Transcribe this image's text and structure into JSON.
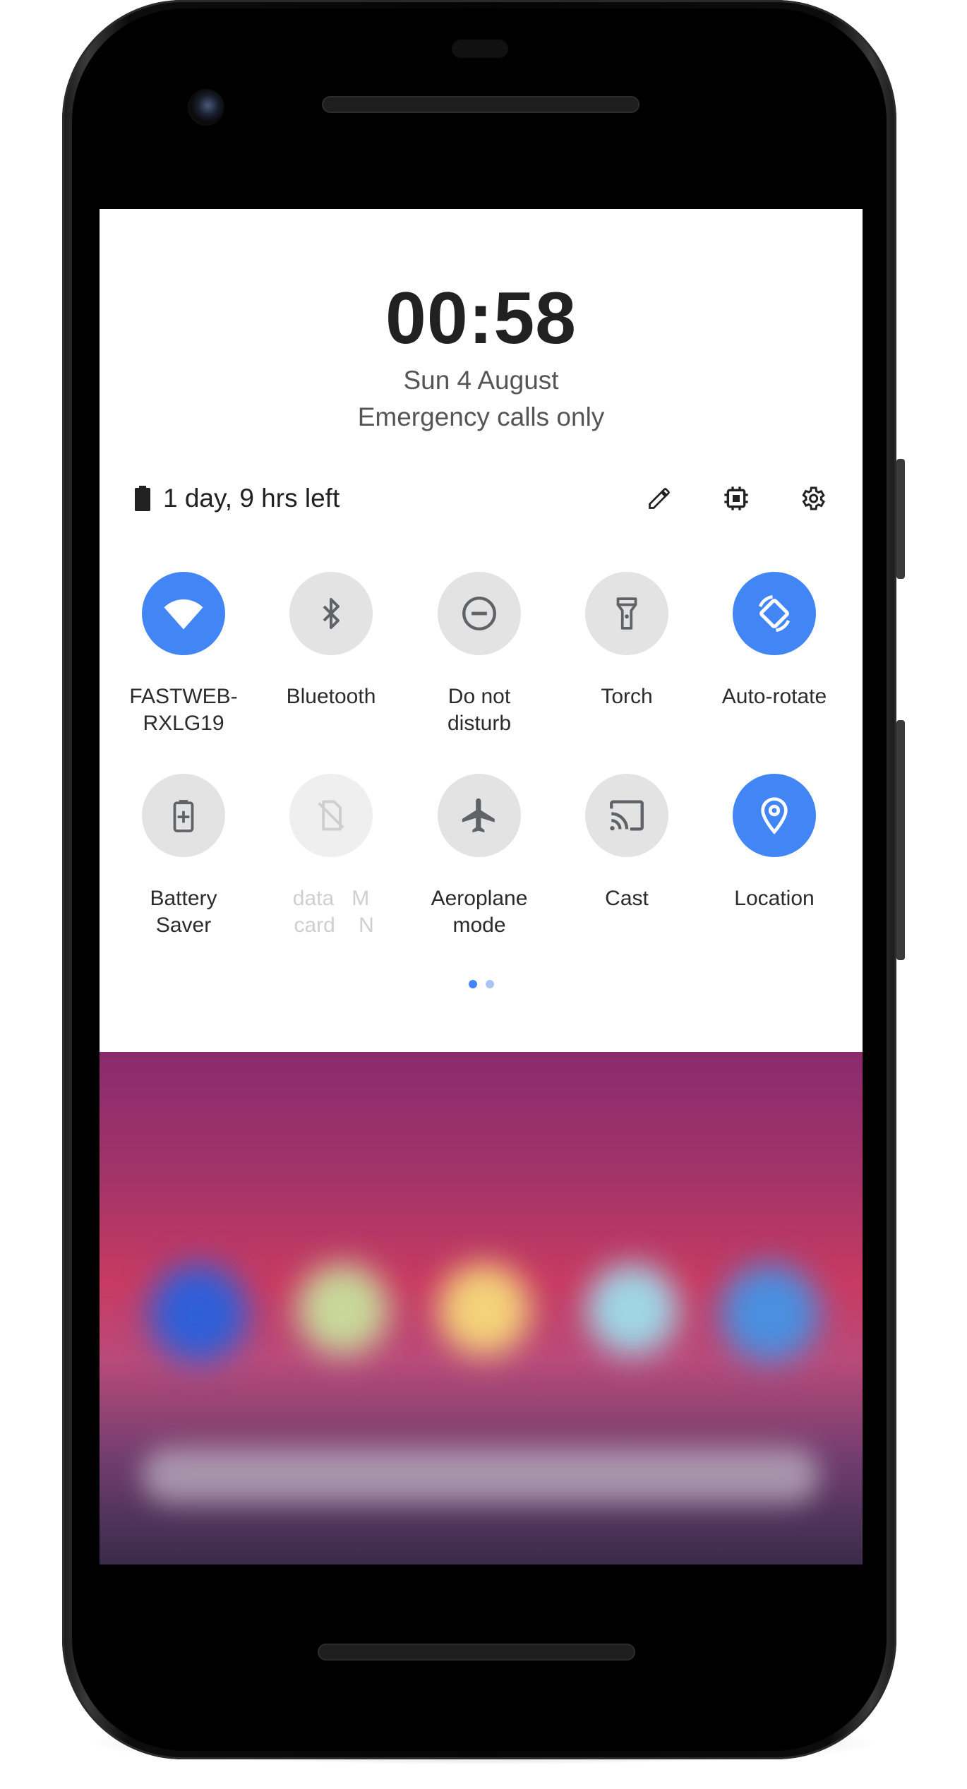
{
  "status": {
    "time": "00:58",
    "date": "Sun 4 August",
    "carrier": "Emergency calls only",
    "battery_text": "1 day, 9 hrs left"
  },
  "header_icons": [
    {
      "name": "edit-icon"
    },
    {
      "name": "chip-icon"
    },
    {
      "name": "settings-icon"
    }
  ],
  "tiles": [
    {
      "label": "FASTWEB-\nRXLG19",
      "icon": "wifi-icon",
      "active": true
    },
    {
      "label": "Bluetooth",
      "icon": "bluetooth-icon",
      "active": false
    },
    {
      "label": "Do not\ndisturb",
      "icon": "do-not-disturb-icon",
      "active": false
    },
    {
      "label": "Torch",
      "icon": "torch-icon",
      "active": false
    },
    {
      "label": "Auto-rotate",
      "icon": "auto-rotate-icon",
      "active": true
    },
    {
      "label": "Battery\nSaver",
      "icon": "battery-saver-icon",
      "active": false
    },
    {
      "label": "data   M\n card    N",
      "icon": "no-sim-icon",
      "active": false,
      "disabled": true
    },
    {
      "label": "Aeroplane\nmode",
      "icon": "aeroplane-icon",
      "active": false
    },
    {
      "label": "Cast",
      "icon": "cast-icon",
      "active": false
    },
    {
      "label": "Location",
      "icon": "location-icon",
      "active": true
    }
  ],
  "pager": {
    "pages": 2,
    "current": 1
  },
  "colors": {
    "accent": "#4285f4",
    "tile_inactive": "#e3e3e3",
    "icon_inactive": "#5f6368",
    "text_primary": "#212121"
  }
}
